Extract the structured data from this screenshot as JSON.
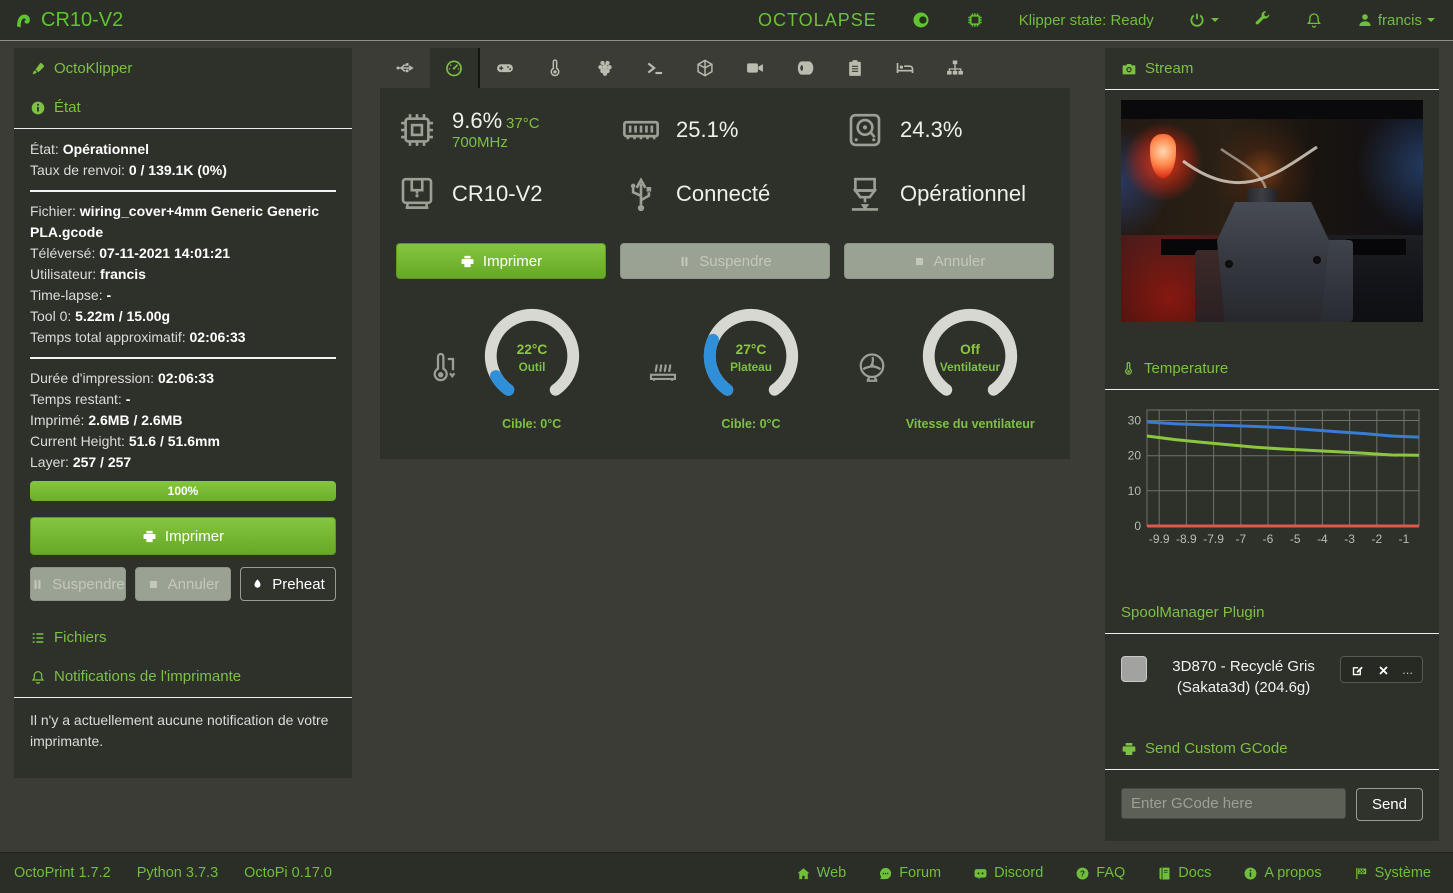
{
  "colors": {
    "accent_green": "#7cc142",
    "button_green": "#74b82e",
    "gauge_blue": "#2f8fd8",
    "gauge_track": "#d8d8d2",
    "panel_bg": "#2e302a",
    "page_bg": "#3a3c35"
  },
  "navbar": {
    "brand": "CR10-V2",
    "octolapse_label": "OCTOLAPSE",
    "klipper_state": "Klipper state: Ready",
    "username": "francis"
  },
  "sidebar": {
    "octoklipper_header": "OctoKlipper",
    "state_header": "État",
    "state_lines": [
      {
        "label": "État:",
        "value": "Opérationnel"
      },
      {
        "label": "Taux de renvoi:",
        "value": "0 / 139.1K (0%)"
      }
    ],
    "file_lines": [
      {
        "label": "Fichier:",
        "value": "wiring_cover+4mm Generic Generic PLA.gcode"
      },
      {
        "label": "Téléversé:",
        "value": "07-11-2021 14:01:21"
      },
      {
        "label": "Utilisateur:",
        "value": "francis"
      },
      {
        "label": "Time-lapse:",
        "value": "-"
      },
      {
        "label": "Tool 0:",
        "value": "5.22m / 15.00g"
      },
      {
        "label": "Temps total approximatif:",
        "value": "02:06:33"
      }
    ],
    "job_lines": [
      {
        "label": "Durée d'impression:",
        "value": "02:06:33"
      },
      {
        "label": "Temps restant:",
        "value": "-"
      },
      {
        "label": "Imprimé:",
        "value": "2.6MB / 2.6MB"
      },
      {
        "label": "Current Height:",
        "value": "51.6 / 51.6mm"
      },
      {
        "label": "Layer:",
        "value": "257 / 257"
      }
    ],
    "progress_label": "100%",
    "print_button": "Imprimer",
    "pause_button": "Suspendre",
    "cancel_button": "Annuler",
    "preheat_button": "Preheat",
    "files_header": "Fichiers",
    "notifications_header": "Notifications de l'imprimante",
    "notifications_empty": "Il n'y a actuellement aucune notification de votre imprimante."
  },
  "tabs": [
    {
      "name": "connection",
      "icon": "usb-icon"
    },
    {
      "name": "dashboard",
      "icon": "tachometer-icon",
      "active": true
    },
    {
      "name": "control",
      "icon": "gamepad-icon"
    },
    {
      "name": "temperature",
      "icon": "thermometer-icon"
    },
    {
      "name": "octopi",
      "icon": "raspberry-icon"
    },
    {
      "name": "terminal",
      "icon": "terminal-icon"
    },
    {
      "name": "gcode-viewer",
      "icon": "cube-icon"
    },
    {
      "name": "timelapse",
      "icon": "video-camera-icon"
    },
    {
      "name": "spoolmanager",
      "icon": "paper-roll-icon"
    },
    {
      "name": "gcode-editor",
      "icon": "clipboard-icon"
    },
    {
      "name": "bed-visualizer",
      "icon": "bed-icon"
    },
    {
      "name": "plugin-manager",
      "icon": "sitemap-icon"
    }
  ],
  "dashboard": {
    "cpu_percent": "9.6%",
    "cpu_temp": "37°C",
    "cpu_freq": "700MHz",
    "ram_percent": "25.1%",
    "disk_percent": "24.3%",
    "printer_profile": "CR10-V2",
    "connection_state": "Connecté",
    "printer_state": "Opérationnel",
    "print_button": "Imprimer",
    "pause_button": "Suspendre",
    "cancel_button": "Annuler",
    "gauges": [
      {
        "value": "22°C",
        "label": "Outil",
        "caption": "Cible: 0°C",
        "fraction": 0.09
      },
      {
        "value": "27°C",
        "label": "Plateau",
        "caption": "Cible: 0°C",
        "fraction": 0.27
      },
      {
        "value": "Off",
        "label": "Ventilateur",
        "caption": "Vitesse du ventilateur",
        "fraction": 0
      }
    ]
  },
  "stream": {
    "header": "Stream"
  },
  "temperature_section": {
    "header": "Temperature"
  },
  "chart_data": {
    "type": "line",
    "title": "Temperature",
    "xtick_labels": [
      "-9.9",
      "-8.9",
      "-7.9",
      "-7",
      "-6",
      "-5",
      "-4",
      "-3",
      "-2",
      "-1"
    ],
    "yticks": [
      0,
      10,
      20,
      30
    ],
    "ylim": [
      0,
      33
    ],
    "grid": true,
    "legend_position": "none",
    "series": [
      {
        "name": "bed_actual",
        "color": "#3a7bd5",
        "values": [
          29.6,
          29.1,
          28.8,
          28.6,
          28.3,
          28.0,
          27.4,
          26.8,
          26.3,
          25.6,
          25.3
        ]
      },
      {
        "name": "tool_actual",
        "color": "#8cc63f",
        "values": [
          25.6,
          24.6,
          23.8,
          23.1,
          22.4,
          21.9,
          21.5,
          21.1,
          20.7,
          20.2,
          20.1
        ]
      },
      {
        "name": "target",
        "color": "#e2574c",
        "values": [
          0,
          0,
          0,
          0,
          0,
          0,
          0,
          0,
          0,
          0,
          0
        ]
      }
    ]
  },
  "spoolmanager": {
    "header": "SpoolManager Plugin",
    "spool_name": "3D870 - Recyclé Gris",
    "spool_details": "(Sakata3d) (204.6g)",
    "more_label": "..."
  },
  "gcode": {
    "header": "Send Custom GCode",
    "input_placeholder": "Enter GCode here",
    "send_button": "Send"
  },
  "footer": {
    "versions": [
      "OctoPrint 1.7.2",
      "Python 3.7.3",
      "OctoPi 0.17.0"
    ],
    "links": [
      {
        "label": "Web"
      },
      {
        "label": "Forum"
      },
      {
        "label": "Discord"
      },
      {
        "label": "FAQ"
      },
      {
        "label": "Docs"
      },
      {
        "label": "A propos"
      },
      {
        "label": "Système"
      }
    ]
  }
}
